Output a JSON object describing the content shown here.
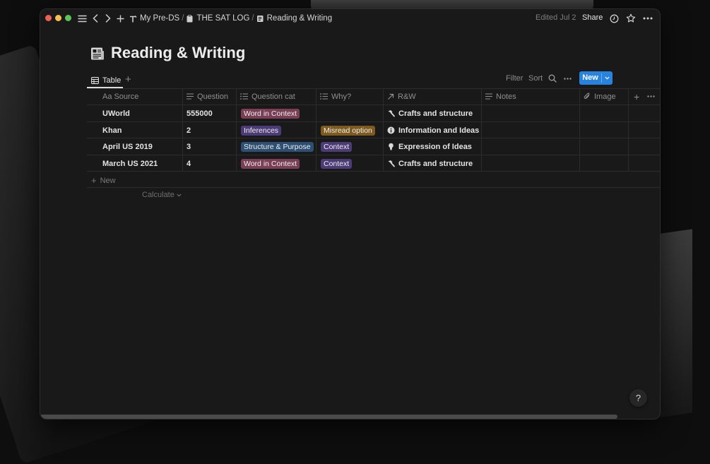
{
  "breadcrumbs": [
    {
      "label": "My Pre-DS",
      "icon": "pickaxe-icon"
    },
    {
      "label": "THE SAT LOG",
      "icon": "clipboard-icon"
    },
    {
      "label": "Reading & Writing",
      "icon": "newspaper-icon"
    }
  ],
  "topbar": {
    "edited": "Edited Jul 2",
    "share_label": "Share"
  },
  "page": {
    "title": "Reading & Writing",
    "icon": "newspaper-icon"
  },
  "view": {
    "tab_label": "Table",
    "add_view_icon": "plus-icon"
  },
  "toolbar": {
    "filter_label": "Filter",
    "sort_label": "Sort",
    "new_label": "New"
  },
  "columns": [
    {
      "key": "source",
      "label": "Source",
      "prefix": "Aa",
      "icon": "title-icon"
    },
    {
      "key": "question",
      "label": "Question",
      "icon": "text-icon"
    },
    {
      "key": "question_cat",
      "label": "Question cat",
      "icon": "list-icon"
    },
    {
      "key": "why",
      "label": "Why?",
      "icon": "list-icon"
    },
    {
      "key": "rw",
      "label": "R&W",
      "icon": "relation-arrow-icon"
    },
    {
      "key": "notes",
      "label": "Notes",
      "icon": "text-icon"
    },
    {
      "key": "image",
      "label": "Image",
      "icon": "paperclip-icon"
    }
  ],
  "rows": [
    {
      "source": "UWorld",
      "question": "555000",
      "question_cat": {
        "label": "Word in Context",
        "color": "#7a3f55"
      },
      "why": null,
      "rw": {
        "label": "Crafts and structure",
        "icon": "hammer-icon"
      }
    },
    {
      "source": "Khan",
      "question": "2",
      "question_cat": {
        "label": "Inferences",
        "color": "#4c3b77"
      },
      "why": {
        "label": "Misread option",
        "color": "#7e5a1e"
      },
      "rw": {
        "label": "Information and Ideas",
        "icon": "info-icon"
      }
    },
    {
      "source": "April US 2019",
      "question": "3",
      "question_cat": {
        "label": "Structure & Purpose",
        "color": "#2c4f73"
      },
      "why": {
        "label": "Context",
        "color": "#4c3b77"
      },
      "rw": {
        "label": "Expression of Ideas",
        "icon": "lightbulb-icon"
      }
    },
    {
      "source": "March US 2021",
      "question": "4",
      "question_cat": {
        "label": "Word in Context",
        "color": "#7a3f55"
      },
      "why": {
        "label": "Context",
        "color": "#4c3b77"
      },
      "rw": {
        "label": "Crafts and structure",
        "icon": "hammer-icon"
      }
    }
  ],
  "new_row_label": "New",
  "calculate_label": "Calculate",
  "help_label": "?",
  "colors": {
    "accent": "#2783de",
    "background": "#191919",
    "border": "#2c2c2c"
  }
}
